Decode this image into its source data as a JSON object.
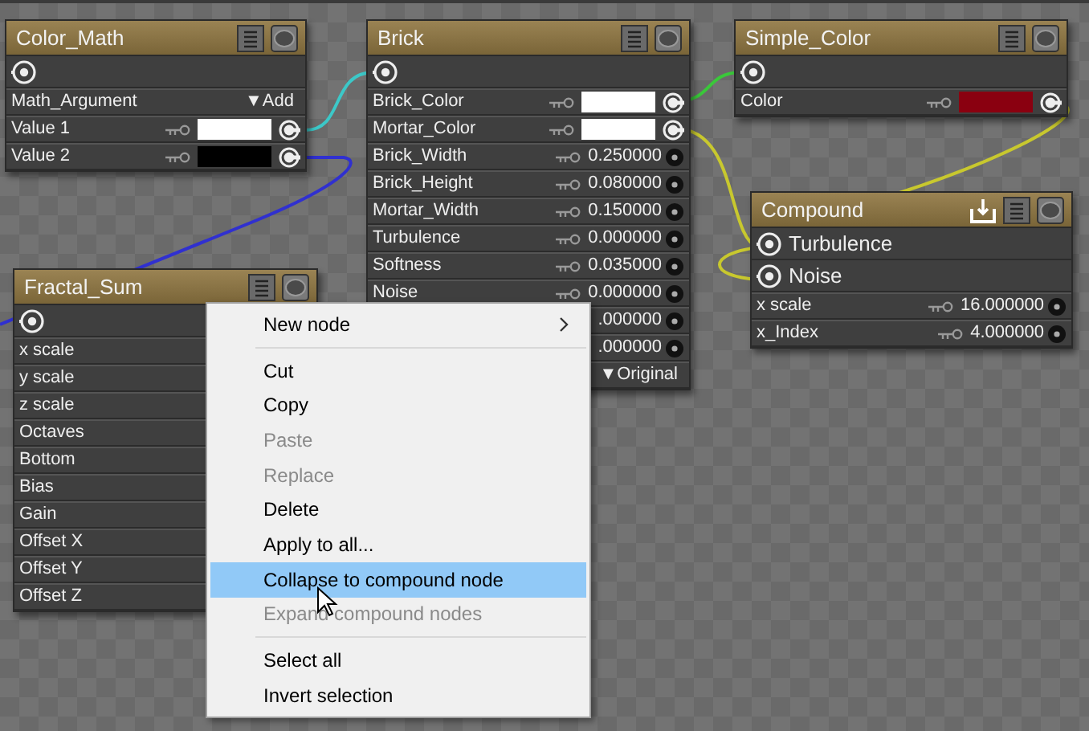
{
  "nodes": [
    {
      "title": "Color_Math",
      "kind": "shader",
      "rows": [
        {
          "label": "Math_Argument",
          "kind": "dropdown",
          "value": "▼Add"
        },
        {
          "label": "Value 1",
          "kind": "color",
          "color": "#ffffff"
        },
        {
          "label": "Value 2",
          "kind": "color",
          "color": "#000000"
        }
      ]
    },
    {
      "title": "Brick",
      "kind": "shader",
      "rows": [
        {
          "label": "Brick_Color",
          "kind": "color",
          "color": "#ffffff"
        },
        {
          "label": "Mortar_Color",
          "kind": "color",
          "color": "#ffffff"
        },
        {
          "label": "Brick_Width",
          "kind": "number",
          "value": "0.250000"
        },
        {
          "label": "Brick_Height",
          "kind": "number",
          "value": "0.080000"
        },
        {
          "label": "Mortar_Width",
          "kind": "number",
          "value": "0.150000"
        },
        {
          "label": "Turbulence",
          "kind": "number",
          "value": "0.000000"
        },
        {
          "label": "Softness",
          "kind": "number",
          "value": "0.035000"
        },
        {
          "label": "Noise",
          "kind": "number",
          "value": "0.000000"
        },
        {
          "kind": "number",
          "value": ".000000"
        },
        {
          "kind": "number",
          "value": ".000000"
        },
        {
          "kind": "dropdown",
          "value": "▼Original"
        }
      ]
    },
    {
      "title": "Simple_Color",
      "kind": "shader",
      "rows": [
        {
          "label": "Color",
          "kind": "color",
          "color": "#8a0010"
        }
      ]
    },
    {
      "title": "Compound",
      "kind": "compound",
      "inputs": [
        {
          "label": "Turbulence"
        },
        {
          "label": "Noise"
        }
      ],
      "rows": [
        {
          "label": "x scale",
          "kind": "number",
          "value": "16.000000"
        },
        {
          "label": "x_Index",
          "kind": "number",
          "value": "4.000000"
        }
      ]
    },
    {
      "title": "Fractal_Sum",
      "kind": "shader",
      "rows": [
        {
          "label": "x scale",
          "kind": "label"
        },
        {
          "label": "y scale",
          "kind": "label"
        },
        {
          "label": "z scale",
          "kind": "label"
        },
        {
          "label": "Octaves",
          "kind": "label"
        },
        {
          "label": "Bottom",
          "kind": "label"
        },
        {
          "label": "Bias",
          "kind": "label"
        },
        {
          "label": "Gain",
          "kind": "label"
        },
        {
          "label": "Offset X",
          "kind": "label"
        },
        {
          "label": "Offset Y",
          "kind": "label"
        },
        {
          "label": "Offset Z",
          "kind": "label"
        }
      ]
    }
  ],
  "context_menu": {
    "sections": [
      [
        {
          "label": "New node",
          "disabled": false,
          "selected": false,
          "submenu": true
        }
      ],
      [
        {
          "label": "Cut",
          "disabled": false,
          "selected": false
        },
        {
          "label": "Copy",
          "disabled": false,
          "selected": false
        },
        {
          "label": "Paste",
          "disabled": true,
          "selected": false
        },
        {
          "label": "Replace",
          "disabled": true,
          "selected": false
        },
        {
          "label": "Delete",
          "disabled": false,
          "selected": false
        },
        {
          "label": "Apply to all...",
          "disabled": false,
          "selected": false
        },
        {
          "label": "Collapse to compound node",
          "disabled": false,
          "selected": true
        },
        {
          "label": "Expand compound nodes",
          "disabled": true,
          "selected": false
        }
      ],
      [
        {
          "label": "Select all",
          "disabled": false,
          "selected": false
        },
        {
          "label": "Invert selection",
          "disabled": false,
          "selected": false
        }
      ]
    ]
  }
}
